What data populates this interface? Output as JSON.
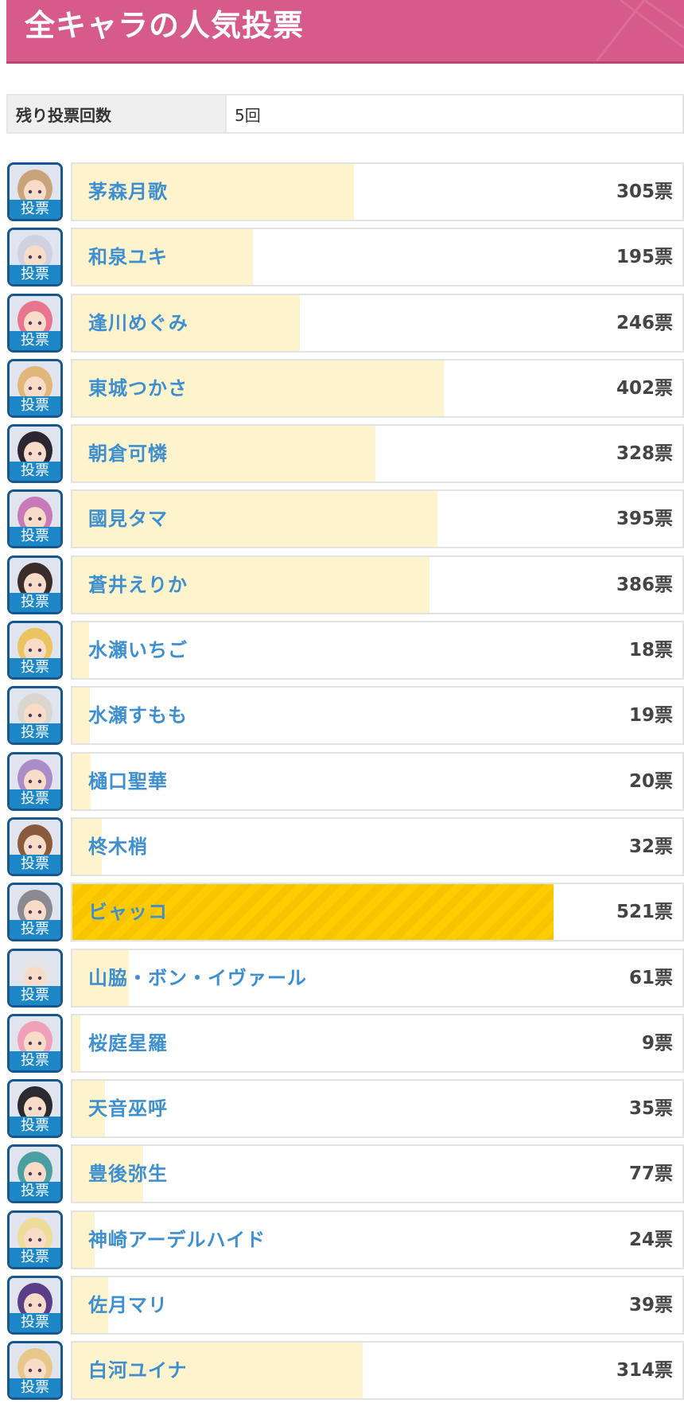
{
  "header": {
    "title": "全キャラの人気投票"
  },
  "remaining": {
    "label": "残り投票回数",
    "value": "5回"
  },
  "vote_button_label": "投票",
  "unit": "票",
  "bar_scale_max": 660,
  "characters": [
    {
      "name": "茅森月歌",
      "votes": "305票",
      "count": 305,
      "hair": "#c9a37a",
      "top": false
    },
    {
      "name": "和泉ユキ",
      "votes": "195票",
      "count": 195,
      "hair": "#cfd0e0",
      "top": false
    },
    {
      "name": "逢川めぐみ",
      "votes": "246票",
      "count": 246,
      "hair": "#e8748f",
      "top": false
    },
    {
      "name": "東城つかさ",
      "votes": "402票",
      "count": 402,
      "hair": "#e0b67a",
      "top": false
    },
    {
      "name": "朝倉可憐",
      "votes": "328票",
      "count": 328,
      "hair": "#2c2633",
      "top": false
    },
    {
      "name": "國見タマ",
      "votes": "395票",
      "count": 395,
      "hair": "#c87ab8",
      "top": false
    },
    {
      "name": "蒼井えりか",
      "votes": "386票",
      "count": 386,
      "hair": "#3a2d2a",
      "top": false
    },
    {
      "name": "水瀬いちご",
      "votes": "18票",
      "count": 18,
      "hair": "#e9c460",
      "top": false
    },
    {
      "name": "水瀬すもも",
      "votes": "19票",
      "count": 19,
      "hair": "#d9d6d0",
      "top": false
    },
    {
      "name": "樋口聖華",
      "votes": "20票",
      "count": 20,
      "hair": "#a98cc8",
      "top": false
    },
    {
      "name": "柊木梢",
      "votes": "32票",
      "count": 32,
      "hair": "#8a5a3c",
      "top": false
    },
    {
      "name": "ビャッコ",
      "votes": "521票",
      "count": 521,
      "hair": "#8a8a90",
      "top": true
    },
    {
      "name": "山脇・ボン・イヴァール",
      "votes": "61票",
      "count": 61,
      "hair": "#e4e4e8",
      "top": false
    },
    {
      "name": "桜庭星羅",
      "votes": "9票",
      "count": 9,
      "hair": "#f0a0b8",
      "top": false
    },
    {
      "name": "天音巫呼",
      "votes": "35票",
      "count": 35,
      "hair": "#2a2a30",
      "top": false
    },
    {
      "name": "豊後弥生",
      "votes": "77票",
      "count": 77,
      "hair": "#4aa0a0",
      "top": false
    },
    {
      "name": "神崎アーデルハイド",
      "votes": "24票",
      "count": 24,
      "hair": "#eddc9a",
      "top": false
    },
    {
      "name": "佐月マリ",
      "votes": "39票",
      "count": 39,
      "hair": "#5a3f88",
      "top": false
    },
    {
      "name": "白河ユイナ",
      "votes": "314票",
      "count": 314,
      "hair": "#e8c88a",
      "top": false
    }
  ]
}
